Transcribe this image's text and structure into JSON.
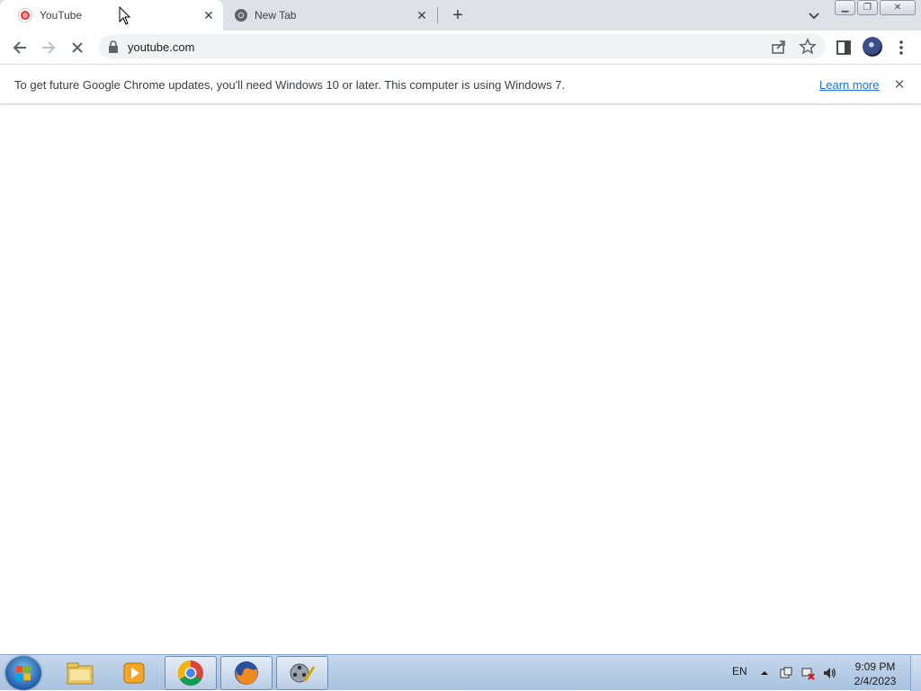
{
  "browser": {
    "tabs": [
      {
        "title": "YouTube",
        "favicon": "youtube-icon",
        "active": true
      },
      {
        "title": "New Tab",
        "favicon": "chrome-icon",
        "active": false
      }
    ],
    "toolbar": {
      "url": "youtube.com",
      "loading": true
    },
    "infobar": {
      "message": "To get future Google Chrome updates, you'll need Windows 10 or later. This computer is using Windows 7.",
      "link": "Learn more"
    }
  },
  "taskbar": {
    "pinned": [
      "windows-explorer-icon",
      "media-player-icon",
      "chrome-icon",
      "firefox-icon",
      "movie-maker-icon"
    ],
    "language": "EN",
    "clock_time": "9:09 PM",
    "clock_date": "2/4/2023"
  },
  "colors": {
    "tabstrip": "#dee1e6",
    "link": "#1a73e8",
    "taskbar": "#b5cae3"
  }
}
